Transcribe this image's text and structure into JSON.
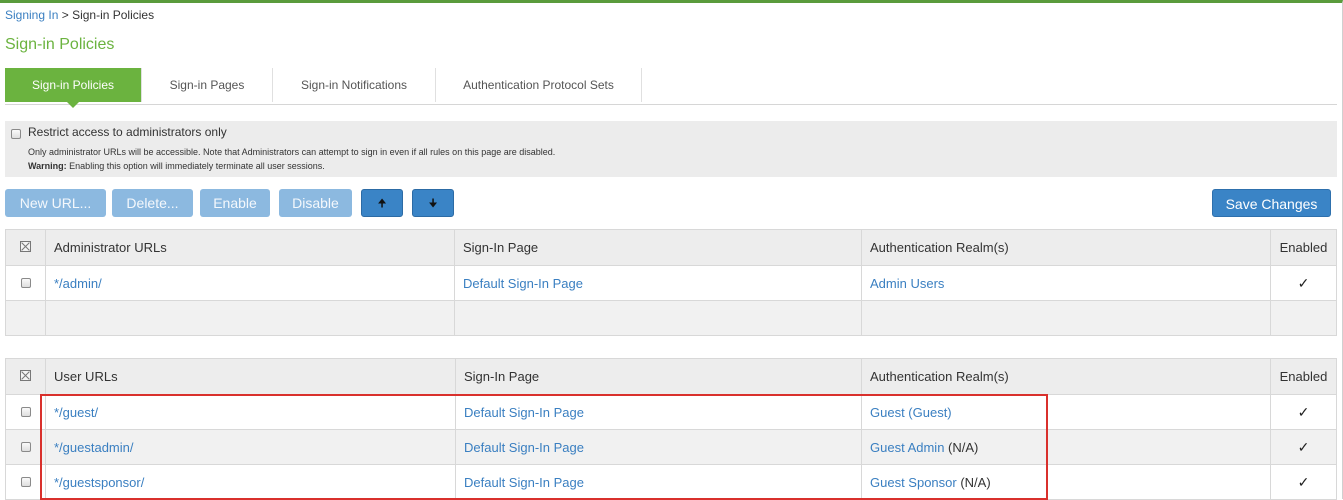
{
  "breadcrumb": {
    "parent": "Signing In",
    "separator": " > ",
    "current": "Sign-in Policies"
  },
  "page_title": "Sign-in Policies",
  "tabs": [
    {
      "label": "Sign-in Policies",
      "active": true
    },
    {
      "label": "Sign-in Pages",
      "active": false
    },
    {
      "label": "Sign-in Notifications",
      "active": false
    },
    {
      "label": "Authentication Protocol Sets",
      "active": false
    }
  ],
  "restrict": {
    "label": "Restrict access to administrators only",
    "checked": false,
    "note": "Only administrator URLs will be accessible. Note that Administrators can attempt to sign in even if all rules on this page are disabled.",
    "warning_label": "Warning:",
    "warning_text": " Enabling this option will immediately terminate all user sessions."
  },
  "toolbar": {
    "new_url": "New URL...",
    "delete": "Delete...",
    "enable": "Enable",
    "disable": "Disable",
    "move_up_icon": "arrow-up",
    "move_down_icon": "arrow-down",
    "move_up_glyph": "🠉",
    "move_down_glyph": "🠋",
    "save": "Save Changes"
  },
  "admin_table": {
    "headers": {
      "url": "Administrator URLs",
      "page": "Sign-In Page",
      "realm": "Authentication Realm(s)",
      "enabled": "Enabled"
    },
    "rows": [
      {
        "url": "*/admin/",
        "page": "Default Sign-In Page",
        "realm": "Admin Users",
        "realm_suffix": "",
        "enabled": "✓"
      }
    ]
  },
  "user_table": {
    "headers": {
      "url": "User URLs",
      "page": "Sign-In Page",
      "realm": "Authentication Realm(s)",
      "enabled": "Enabled"
    },
    "rows": [
      {
        "url": "*/guest/",
        "page": "Default Sign-In Page",
        "realm": "Guest (Guest)",
        "realm_suffix": "",
        "enabled": "✓"
      },
      {
        "url": "*/guestadmin/",
        "page": "Default Sign-In Page",
        "realm": "Guest Admin",
        "realm_suffix": " (N/A)",
        "enabled": "✓"
      },
      {
        "url": "*/guestsponsor/",
        "page": "Default Sign-In Page",
        "realm": "Guest Sponsor",
        "realm_suffix": " (N/A)",
        "enabled": "✓"
      }
    ]
  },
  "colors": {
    "accent_green": "#6bb33f",
    "link_blue": "#3a7fc1",
    "primary_button": "#3a84c6",
    "highlight_red": "#d9302c"
  }
}
